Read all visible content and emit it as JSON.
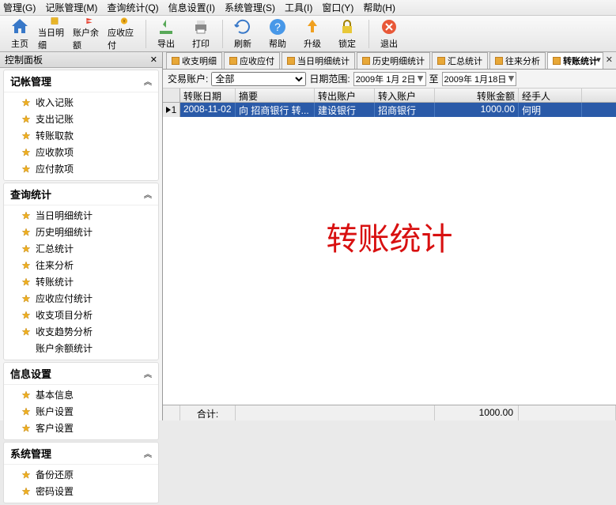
{
  "menu": [
    "管理(G)",
    "记账管理(M)",
    "查询统计(Q)",
    "信息设置(I)",
    "系统管理(S)",
    "工具(I)",
    "窗口(Y)",
    "帮助(H)"
  ],
  "toolbar": [
    {
      "name": "home-icon",
      "label": "主页"
    },
    {
      "name": "detail-icon",
      "label": "当日明细"
    },
    {
      "name": "balance-icon",
      "label": "账户余额"
    },
    {
      "name": "arap-icon",
      "label": "应收应付"
    },
    {
      "name": "export-icon",
      "label": "导出"
    },
    {
      "name": "print-icon",
      "label": "打印"
    },
    {
      "name": "refresh-icon",
      "label": "刷新"
    },
    {
      "name": "help-icon",
      "label": "帮助"
    },
    {
      "name": "upgrade-icon",
      "label": "升级"
    },
    {
      "name": "lock-icon",
      "label": "锁定"
    },
    {
      "name": "exit-icon",
      "label": "退出"
    }
  ],
  "side_title": "控制面板",
  "groups": [
    {
      "title": "记帐管理",
      "items": [
        "收入记账",
        "支出记账",
        "转账取款",
        "应收款项",
        "应付款项"
      ]
    },
    {
      "title": "查询统计",
      "items": [
        "当日明细统计",
        "历史明细统计",
        "汇总统计",
        "往来分析",
        "转账统计",
        "应收应付统计",
        "收支项目分析",
        "收支趋势分析",
        "账户余额统计"
      ]
    },
    {
      "title": "信息设置",
      "items": [
        "基本信息",
        "账户设置",
        "客户设置"
      ]
    },
    {
      "title": "系统管理",
      "items": [
        "备份还原",
        "密码设置"
      ]
    }
  ],
  "tabs": [
    "收支明细",
    "应收应付",
    "当日明细统计",
    "历史明细统计",
    "汇总统计",
    "往来分析",
    "转账统计"
  ],
  "active_tab": 6,
  "filter": {
    "account_label": "交易账户:",
    "account_value": "全部",
    "range_label": "日期范围:",
    "from": "2009年 1月 2日",
    "to_label": "至",
    "to": "2009年 1月18日"
  },
  "columns": [
    "转账日期",
    "摘要",
    "转出账户",
    "转入账户",
    "转账金额",
    "经手人"
  ],
  "row": {
    "num": "1",
    "date": "2008-11-02",
    "summary": "向 招商银行 转...",
    "out": "建设银行",
    "in": "招商银行",
    "amt": "1000.00",
    "op": "何明"
  },
  "watermark": "转账统计",
  "footer": {
    "label": "合计:",
    "total": "1000.00"
  }
}
